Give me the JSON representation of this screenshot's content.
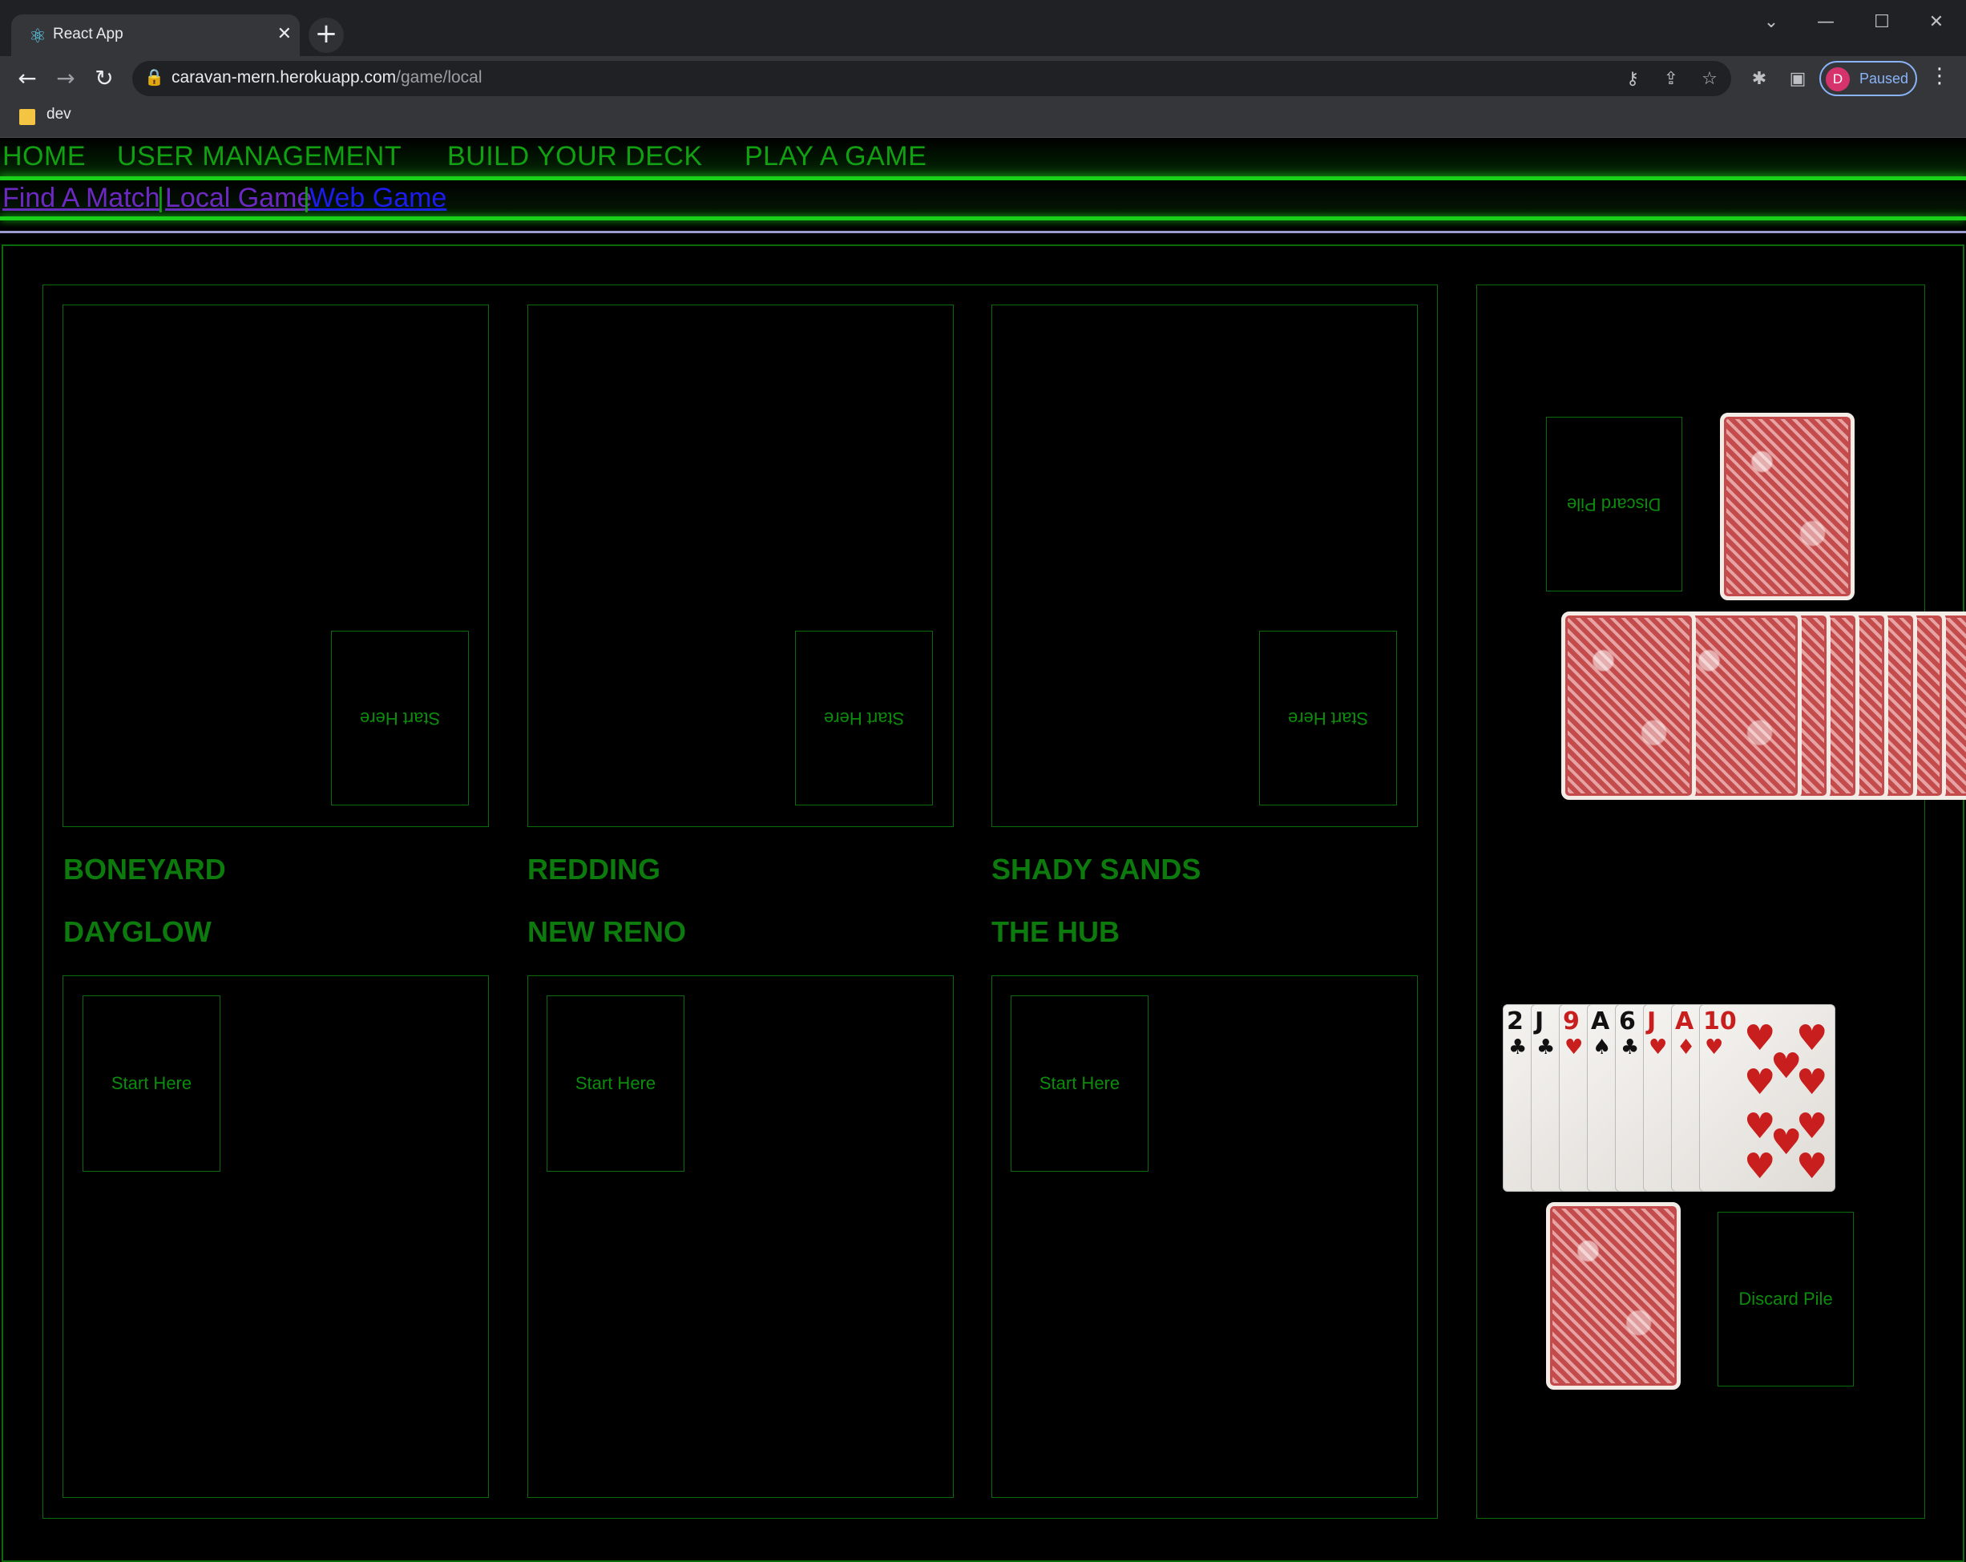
{
  "browser": {
    "tab_title": "React App",
    "url_host": "caravan-mern.herokuapp.com",
    "url_path": "/game/local",
    "bookmark": "dev",
    "profile_initial": "D",
    "profile_label": "Paused"
  },
  "nav": {
    "home": "HOME",
    "user_management": "USER MANAGEMENT",
    "build_deck": "BUILD YOUR DECK",
    "play_game": "PLAY A GAME"
  },
  "subnav": {
    "find_match": "Find A Match",
    "separator": "|",
    "local_game": "Local Game",
    "web_game": "Web Game"
  },
  "board": {
    "slot_label": "Start Here",
    "opponent_caravans": [
      "BONEYARD",
      "REDDING",
      "SHADY SANDS"
    ],
    "player_caravans": [
      "DAYGLOW",
      "NEW RENO",
      "THE HUB"
    ],
    "opponent_discard": "Discard Pile",
    "player_discard": "Discard Pile",
    "opponent_hand_count": 8,
    "player_hand": [
      {
        "rank": "2",
        "suit": "♣",
        "color": "black"
      },
      {
        "rank": "J",
        "suit": "♣",
        "color": "black"
      },
      {
        "rank": "9",
        "suit": "♥",
        "color": "red"
      },
      {
        "rank": "A",
        "suit": "♠",
        "color": "black"
      },
      {
        "rank": "6",
        "suit": "♣",
        "color": "black"
      },
      {
        "rank": "J",
        "suit": "♥",
        "color": "red"
      },
      {
        "rank": "A",
        "suit": "♦",
        "color": "red"
      },
      {
        "rank": "10",
        "suit": "♥",
        "color": "red"
      }
    ]
  },
  "colors": {
    "accent": "#19d119",
    "text_green": "#0d7a0d",
    "border_green": "#0a6b0a"
  }
}
